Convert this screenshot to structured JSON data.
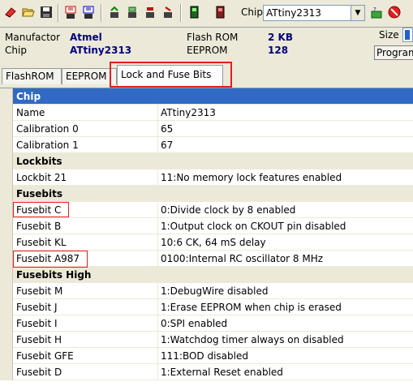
{
  "toolbar": {
    "chip_label": "Chip",
    "chip_value": "ATtiny2313"
  },
  "info": {
    "manufactor_label": "Manufactor",
    "manufactor_value": "Atmel",
    "chip_label": "Chip",
    "chip_value": "ATtiny2313",
    "flash_label": "Flash ROM",
    "flash_value": "2 KB",
    "eeprom_label": "EEPROM",
    "eeprom_value": "128",
    "size_label": "Size",
    "program_button": "Program"
  },
  "tabs": [
    {
      "label": "FlashROM"
    },
    {
      "label": "EEPROM"
    },
    {
      "label": "Lock and Fuse Bits"
    }
  ],
  "grid": {
    "rows": [
      {
        "type": "category",
        "name": "Chip",
        "value": ""
      },
      {
        "type": "item",
        "name": "Name",
        "value": "ATtiny2313"
      },
      {
        "type": "item",
        "name": "Calibration 0",
        "value": "65"
      },
      {
        "type": "item",
        "name": "Calibration 1",
        "value": "67"
      },
      {
        "type": "category",
        "name": "Lockbits",
        "value": ""
      },
      {
        "type": "item",
        "name": "Lockbit 21",
        "value": "11:No memory lock features enabled"
      },
      {
        "type": "category",
        "name": "Fusebits",
        "value": ""
      },
      {
        "type": "item",
        "name": "Fusebit C",
        "value": "0:Divide clock by 8 enabled"
      },
      {
        "type": "item",
        "name": "Fusebit B",
        "value": "1:Output clock on CKOUT pin disabled"
      },
      {
        "type": "item",
        "name": "Fusebit KL",
        "value": "10:6 CK, 64 mS delay"
      },
      {
        "type": "item",
        "name": "Fusebit A987",
        "value": "0100:Internal RC oscillator 8 MHz"
      },
      {
        "type": "category",
        "name": "Fusebits High",
        "value": ""
      },
      {
        "type": "item",
        "name": "Fusebit M",
        "value": "1:DebugWire disabled"
      },
      {
        "type": "item",
        "name": "Fusebit J",
        "value": "1:Erase EEPROM when chip is erased"
      },
      {
        "type": "item",
        "name": "Fusebit I",
        "value": "0:SPI enabled"
      },
      {
        "type": "item",
        "name": "Fusebit H",
        "value": "1:Watchdog timer always on disabled"
      },
      {
        "type": "item",
        "name": "Fusebit GFE",
        "value": "111:BOD disabled"
      },
      {
        "type": "item",
        "name": "Fusebit D",
        "value": "1:External Reset enabled"
      }
    ]
  }
}
